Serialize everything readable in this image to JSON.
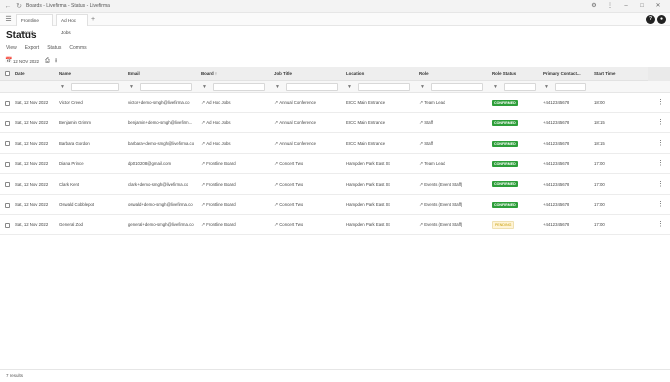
{
  "window": {
    "title": "Boards - Livefirma - Status - Livefirma"
  },
  "tabs": [
    {
      "label": "Frontline Board"
    },
    {
      "label": "Ad Hoc Jobs"
    }
  ],
  "page": {
    "title": "Status",
    "menu": [
      "View",
      "Export",
      "Status",
      "Comms"
    ]
  },
  "toolbar": {
    "date": "12 NOV 2022"
  },
  "columns": [
    {
      "label": "Date"
    },
    {
      "label": "Name"
    },
    {
      "label": "Email"
    },
    {
      "label": "Board"
    },
    {
      "label": "Job Title"
    },
    {
      "label": "Location"
    },
    {
      "label": "Role"
    },
    {
      "label": "Role Status"
    },
    {
      "label": "Primary Contact..."
    },
    {
      "label": "Start Time"
    }
  ],
  "rows": [
    {
      "date": "Sat, 12 Nov 2022",
      "name": "Victor Creed",
      "email": "victor+demo-smgh@livefirma.co",
      "board": "Ad Hoc Jobs",
      "job": "Annual Conference",
      "location": "EICC Main Entrance",
      "role": "Team Lead",
      "status": "CONFIRMED",
      "phone": "+4412345678",
      "start": "18:00"
    },
    {
      "date": "Sat, 12 Nov 2022",
      "name": "Benjamin Grimm",
      "email": "benjamin+demo-smgh@livefirm...",
      "board": "Ad Hoc Jobs",
      "job": "Annual Conference",
      "location": "EICC Main Entrance",
      "role": "Staff",
      "status": "CONFIRMED",
      "phone": "+4412345678",
      "start": "18:15"
    },
    {
      "date": "Sat, 12 Nov 2022",
      "name": "Barbara Gordon",
      "email": "barbara+demo-smgh@livefirma.co",
      "board": "Ad Hoc Jobs",
      "job": "Annual Conference",
      "location": "EICC Main Entrance",
      "role": "Staff",
      "status": "CONFIRMED",
      "phone": "+4412345678",
      "start": "18:15"
    },
    {
      "date": "Sat, 12 Nov 2022",
      "name": "Diana Prince",
      "email": "dp010208@gmail.com",
      "board": "Frontline Board",
      "job": "Concert Two",
      "location": "Hampden Park East St",
      "role": "Team Lead",
      "status": "CONFIRMED",
      "phone": "+4412345678",
      "start": "17:00"
    },
    {
      "date": "Sat, 12 Nov 2022",
      "name": "Clark Kent",
      "email": "clark+demo-smgh@livefirma.co",
      "board": "Frontline Board",
      "job": "Concert Two",
      "location": "Hampden Park East St",
      "role": "Events (Event Staff)",
      "status": "CONFIRMED",
      "phone": "+4412345678",
      "start": "17:00"
    },
    {
      "date": "Sat, 12 Nov 2022",
      "name": "Oswald Cobblepot",
      "email": "oswald+demo-smgh@livefirma.co",
      "board": "Frontline Board",
      "job": "Concert Two",
      "location": "Hampden Park East St",
      "role": "Events (Event Staff)",
      "status": "CONFIRMED",
      "phone": "+4412345678",
      "start": "17:00"
    },
    {
      "date": "Sat, 12 Nov 2022",
      "name": "General Zod",
      "email": "general+demo-smgh@livefirma.co",
      "board": "Frontline Board",
      "job": "Concert Two",
      "location": "Hampden Park East St",
      "role": "Events (Event Staff)",
      "status": "PENDING",
      "phone": "+4412345678",
      "start": "17:00"
    }
  ],
  "footer": {
    "count": "7 results"
  },
  "colors": {
    "confirmed": "#2e9e3a",
    "pending": "#c59a00"
  }
}
